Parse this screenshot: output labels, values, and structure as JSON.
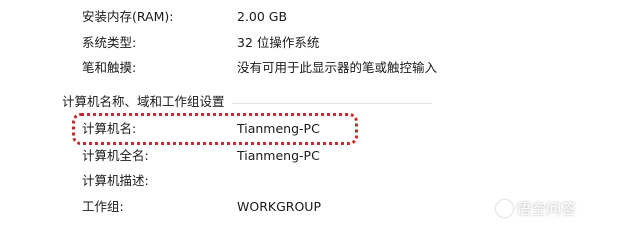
{
  "system": {
    "rows": [
      {
        "label": "安装内存(RAM):",
        "value": "2.00 GB"
      },
      {
        "label": "系统类型:",
        "value": "32 位操作系统"
      },
      {
        "label": "笔和触摸:",
        "value": "没有可用于此显示器的笔或触控输入"
      }
    ]
  },
  "computer_section": {
    "header": "计算机名称、域和工作组设置",
    "rows": [
      {
        "label": "计算机名:",
        "value": "Tianmeng-PC"
      },
      {
        "label": "计算机全名:",
        "value": "Tianmeng-PC"
      },
      {
        "label": "计算机描述:",
        "value": ""
      },
      {
        "label": "工作组:",
        "value": "WORKGROUP"
      }
    ]
  },
  "annotation": {
    "highlight_color": "#c8282d"
  },
  "watermark": {
    "icon": "wukong-logo-icon",
    "text": "悟空问答"
  }
}
